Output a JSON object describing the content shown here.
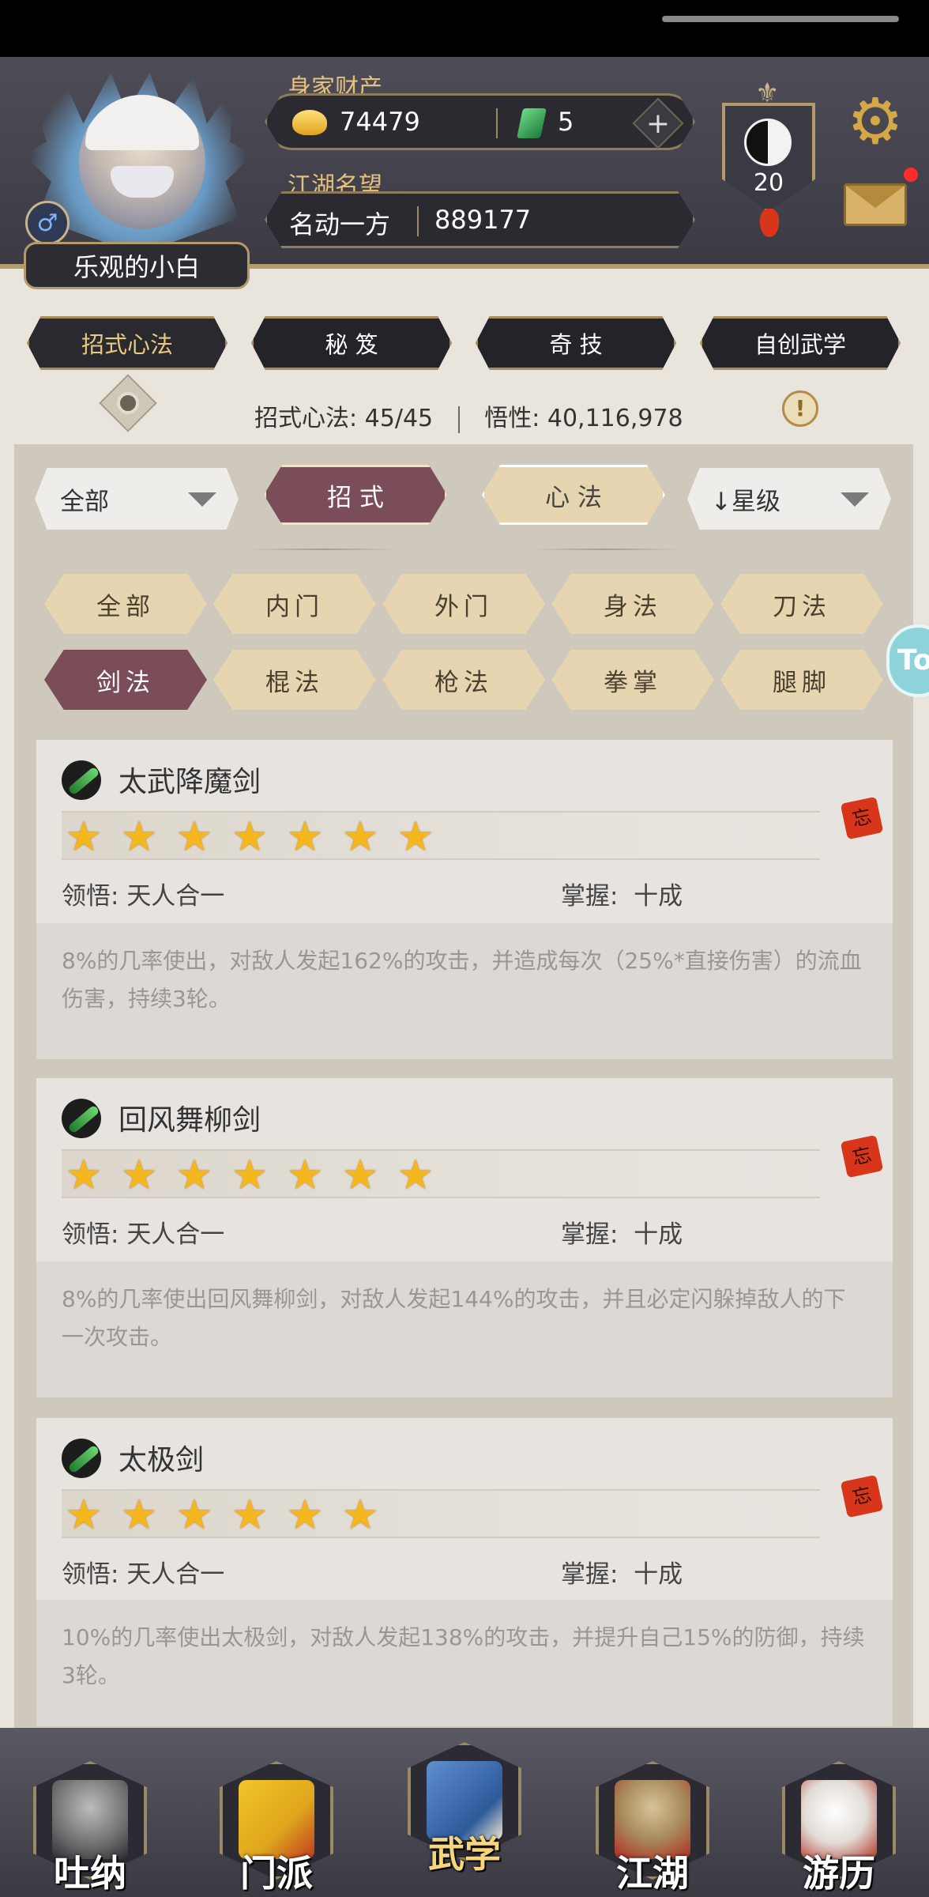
{
  "header": {
    "player_name": "乐观的小白",
    "gender_icon": "♂",
    "wealth_label": "身家财产",
    "gold_amount": "74479",
    "jade_amount": "5",
    "add_icon": "+",
    "reputation_label": "江湖名望",
    "reputation_title": "名动一方",
    "reputation_value": "889177",
    "rank_level": "20",
    "rank_fleur": "⚜",
    "gear_icon": "⚙"
  },
  "main_tabs": [
    {
      "label": "招式心法",
      "active": true
    },
    {
      "label": "秘 笈",
      "active": false
    },
    {
      "label": "奇 技",
      "active": false
    },
    {
      "label": "自创武学",
      "active": false
    }
  ],
  "progress": {
    "skills_label": "招式心法:",
    "skills_value": "45/45",
    "insight_label": "悟性:",
    "insight_value": "40,116,978",
    "info_icon": "!"
  },
  "filters": {
    "scope_select": "全部",
    "type_moves": "招 式",
    "type_mind": "心 法",
    "sort_select": "↓星级"
  },
  "categories_row1": [
    "全部",
    "内门",
    "外门",
    "身法",
    "刀法"
  ],
  "categories_row2": [
    "剑法",
    "棍法",
    "枪法",
    "拳掌",
    "腿脚"
  ],
  "side_tab": "To",
  "skills": [
    {
      "name": "太武降魔剑",
      "stars": 7,
      "insight_label": "领悟:",
      "insight": "天人合一",
      "mastery_label": "掌握:",
      "mastery": "十成",
      "forget_label": "忘",
      "description": "8%的几率使出，对敌人发起162%的攻击，并造成每次（25%*直接伤害）的流血伤害，持续3轮。"
    },
    {
      "name": "回风舞柳剑",
      "stars": 7,
      "insight_label": "领悟:",
      "insight": "天人合一",
      "mastery_label": "掌握:",
      "mastery": "十成",
      "forget_label": "忘",
      "description": "8%的几率使出回风舞柳剑，对敌人发起144%的攻击，并且必定闪躲掉敌人的下一次攻击。"
    },
    {
      "name": "太极剑",
      "stars": 6,
      "insight_label": "领悟:",
      "insight": "天人合一",
      "mastery_label": "掌握:",
      "mastery": "十成",
      "forget_label": "忘",
      "description": "10%的几率使出太极剑，对敌人发起138%的攻击，并提升自己15%的防御，持续3轮。"
    }
  ],
  "bottom_nav": [
    {
      "label": "吐纳",
      "icon": "meditation-icon",
      "active": false
    },
    {
      "label": "门派",
      "icon": "sect-banner-icon",
      "active": false
    },
    {
      "label": "武学",
      "icon": "martial-book-icon",
      "active": true
    },
    {
      "label": "江湖",
      "icon": "straw-hat-icon",
      "active": false
    },
    {
      "label": "游历",
      "icon": "horse-icon",
      "active": false
    }
  ],
  "colors": {
    "accent_gold": "#e5c07b",
    "active_plum": "#7b4d59",
    "tab_beige": "#e6d5b0",
    "star": "#f4b71d",
    "notify_red": "#ff2b2b"
  }
}
